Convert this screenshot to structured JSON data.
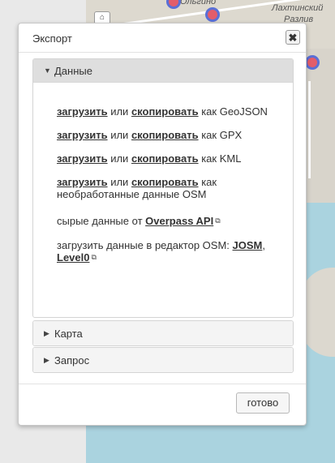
{
  "map": {
    "zoom_glyph": "⌂",
    "labels": {
      "district_top": "Ольгино",
      "district_right_1": "Лахтинский",
      "district_right_2": "Разлив"
    }
  },
  "dialog": {
    "title": "Экспорт",
    "close_icon": "close-icon",
    "close_glyph": "✖",
    "panels": {
      "data": {
        "label": "Данные",
        "expanded": true
      },
      "map": {
        "label": "Карта",
        "expanded": false
      },
      "query": {
        "label": "Запрос",
        "expanded": false
      }
    },
    "export_rows": [
      {
        "download": "загрузить",
        "or": "или",
        "copy": "скопировать",
        "as": "как GeoJSON"
      },
      {
        "download": "загрузить",
        "or": "или",
        "copy": "скопировать",
        "as": "как GPX"
      },
      {
        "download": "загрузить",
        "or": "или",
        "copy": "скопировать",
        "as": "как KML"
      },
      {
        "download": "загрузить",
        "or": "или",
        "copy": "скопировать",
        "as": "как",
        "as_line2": "необработанные данные OSM"
      }
    ],
    "raw_data": {
      "text": "сырые данные от",
      "link": "Overpass API"
    },
    "editor": {
      "text": "загрузить данные в редактор OSM:",
      "josm": "JOSM",
      "comma": ",",
      "level0": "Level0"
    },
    "external_link_glyph": "⧉",
    "done_button": "готово"
  },
  "colors": {
    "marker_fill": "#e35d6a",
    "marker_ring": "#5a6fd6",
    "water": "#aad3df"
  }
}
